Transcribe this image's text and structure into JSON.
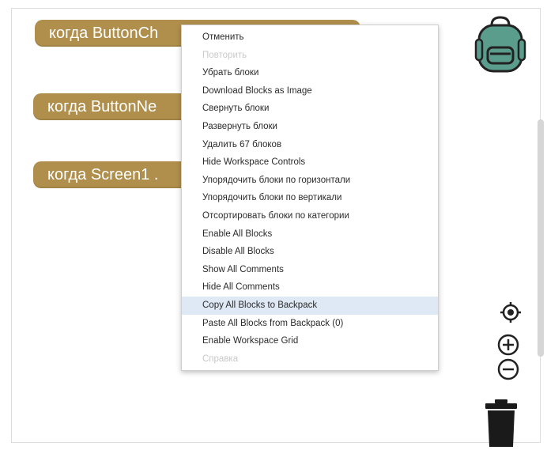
{
  "colors": {
    "block": "#b08f4c",
    "backpack": "#5a9d8c",
    "menu_highlight": "#dfe9f6"
  },
  "blocks": [
    {
      "label": "когда ButtonCh"
    },
    {
      "label": "когда ButtonNe"
    },
    {
      "label": "когда Screen1 ."
    }
  ],
  "context_menu": {
    "items": [
      {
        "label": "Отменить",
        "enabled": true
      },
      {
        "label": "Повторить",
        "enabled": false
      },
      {
        "label": "Убрать блоки",
        "enabled": true
      },
      {
        "label": "Download Blocks as Image",
        "enabled": true
      },
      {
        "label": "Свернуть блоки",
        "enabled": true
      },
      {
        "label": "Развернуть блоки",
        "enabled": true
      },
      {
        "label": "Удалить 67 блоков",
        "enabled": true
      },
      {
        "label": "Hide Workspace Controls",
        "enabled": true
      },
      {
        "label": "Упорядочить блоки по горизонтали",
        "enabled": true
      },
      {
        "label": "Упорядочить блоки по вертикали",
        "enabled": true
      },
      {
        "label": "Отсортировать блоки по категории",
        "enabled": true
      },
      {
        "label": "Enable All Blocks",
        "enabled": true
      },
      {
        "label": "Disable All Blocks",
        "enabled": true
      },
      {
        "label": "Show All Comments",
        "enabled": true
      },
      {
        "label": "Hide All Comments",
        "enabled": true
      },
      {
        "label": "Copy All Blocks to Backpack",
        "enabled": true,
        "highlighted": true
      },
      {
        "label": "Paste All Blocks from Backpack (0)",
        "enabled": true
      },
      {
        "label": "Enable Workspace Grid",
        "enabled": true
      },
      {
        "label": "Справка",
        "enabled": false
      }
    ]
  },
  "controls": {
    "recenter_icon": "target-icon",
    "zoom_in_icon": "plus-circle-icon",
    "zoom_out_icon": "minus-circle-icon",
    "trash_icon": "trash-icon",
    "backpack_icon": "backpack-icon"
  }
}
